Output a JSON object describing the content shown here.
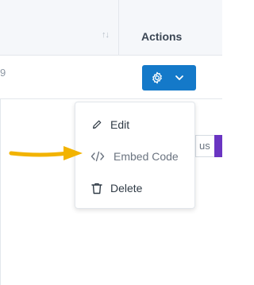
{
  "table": {
    "sort_glyph": "↑↓",
    "actions_header": "Actions",
    "row_fragment": "9"
  },
  "gear_button": {
    "icon": "gear-icon",
    "chevron": "chevron-down-icon"
  },
  "side_button": {
    "label_fragment": "us"
  },
  "menu": {
    "items": [
      {
        "label": "Edit",
        "icon": "pencil-icon"
      },
      {
        "label": "Embed Code",
        "icon": "code-icon"
      },
      {
        "label": "Delete",
        "icon": "trash-icon"
      }
    ]
  },
  "annotation": {
    "icon": "arrow-icon",
    "color": "#f2b300"
  },
  "colors": {
    "primary": "#1479c9",
    "accent_purple": "#6a35c2"
  }
}
